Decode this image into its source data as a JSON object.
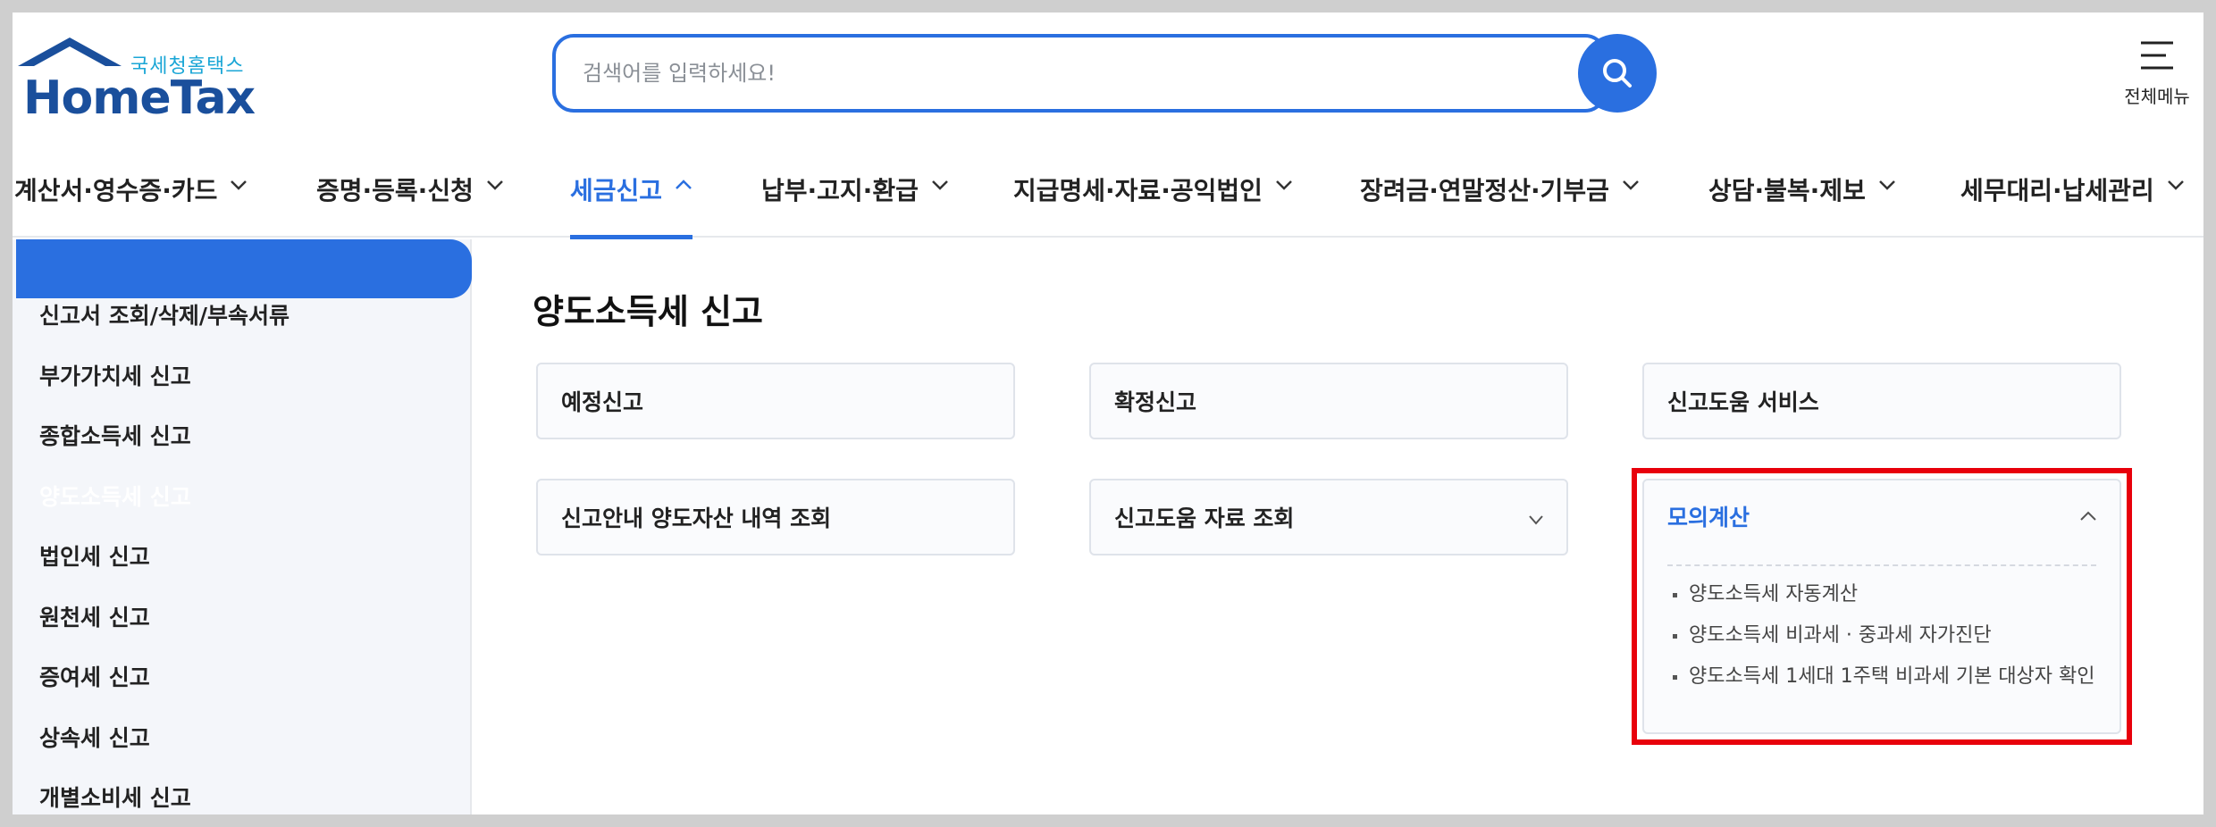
{
  "logo": {
    "sub": "국세청홈택스",
    "main": "HomeTax"
  },
  "search": {
    "placeholder": "검색어를 입력하세요!"
  },
  "allmenu": {
    "label": "전체메뉴"
  },
  "gnb": [
    {
      "label": "계산서·영수증·카드"
    },
    {
      "label": "증명·등록·신청"
    },
    {
      "label": "세금신고"
    },
    {
      "label": "납부·고지·환급"
    },
    {
      "label": "지급명세·자료·공익법인"
    },
    {
      "label": "장려금·연말정산·기부금"
    },
    {
      "label": "상담·불복·제보"
    },
    {
      "label": "세무대리·납세관리"
    }
  ],
  "sidebar": {
    "items": [
      {
        "label": "신고서 조회/삭제/부속서류"
      },
      {
        "label": "부가가치세 신고"
      },
      {
        "label": "종합소득세 신고"
      },
      {
        "label": "양도소득세 신고"
      },
      {
        "label": "법인세 신고"
      },
      {
        "label": "원천세 신고"
      },
      {
        "label": "증여세 신고"
      },
      {
        "label": "상속세 신고"
      },
      {
        "label": "개별소비세 신고"
      }
    ]
  },
  "main": {
    "title": "양도소득세 신고",
    "cards": [
      {
        "label": "예정신고"
      },
      {
        "label": "확정신고"
      },
      {
        "label": "신고도움 서비스"
      },
      {
        "label": "신고안내 양도자산 내역 조회"
      },
      {
        "label": "신고도움 자료 조회"
      }
    ],
    "mock": {
      "title": "모의계산",
      "links": [
        {
          "label": "양도소득세 자동계산"
        },
        {
          "label": "양도소득세 비과세 · 중과세 자가진단"
        },
        {
          "label": "양도소득세 1세대 1주택 비과세 기본 대상자 확인"
        }
      ]
    }
  },
  "colors": {
    "accent": "#2a6fe0",
    "highlight": "#e8000b",
    "logo": "#1a4f9c"
  }
}
